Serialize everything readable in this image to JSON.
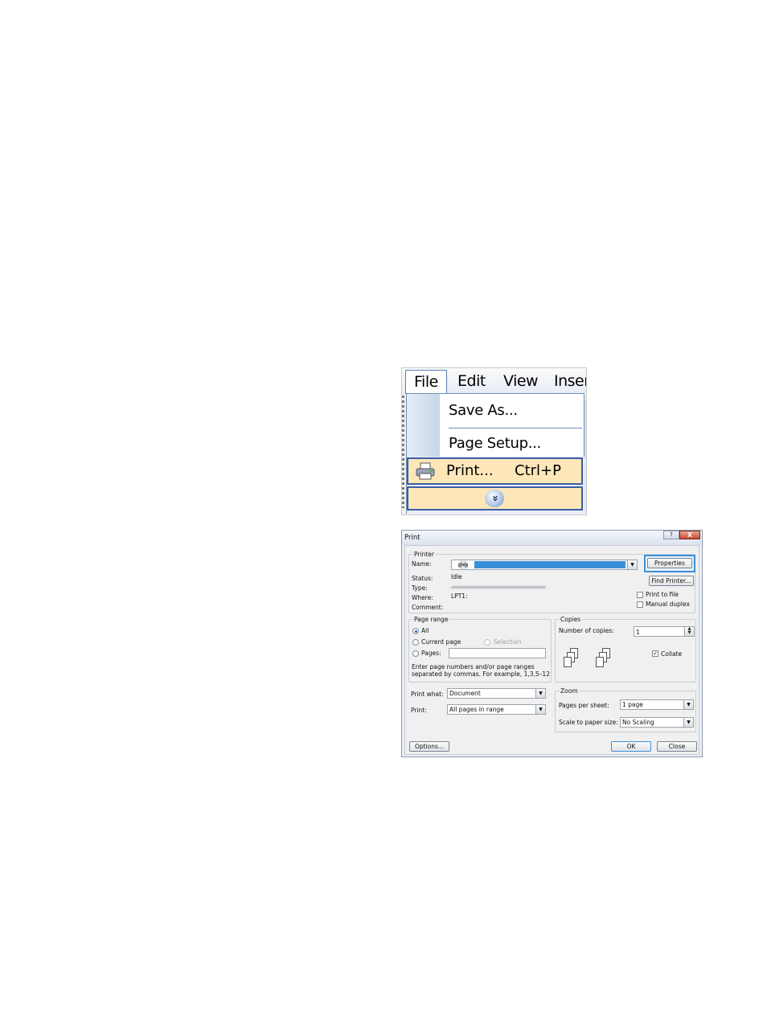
{
  "menu": {
    "bar": {
      "file": "File",
      "edit": "Edit",
      "view": "View",
      "insert": "Inser"
    },
    "items": {
      "save_as": "Save As...",
      "page_setup": "Page Setup...",
      "print": "Print...",
      "print_shortcut": "Ctrl+P",
      "expand_glyph": "»"
    }
  },
  "dialog": {
    "title": "Print",
    "title_help": "?",
    "title_close": "X",
    "printer": {
      "group_label": "Printer",
      "name_label": "Name:",
      "status_label": "Status:",
      "status_value": "Idle",
      "type_label": "Type:",
      "where_label": "Where:",
      "where_value": "LPT1:",
      "comment_label": "Comment:",
      "properties_button": "Properties",
      "find_printer_button": "Find Printer...",
      "print_to_file": "Print to file",
      "manual_duplex": "Manual duplex"
    },
    "page_range": {
      "group_label": "Page range",
      "all": "All",
      "current_page": "Current page",
      "selection": "Selection",
      "pages": "Pages:",
      "hint_line1": "Enter page numbers and/or page ranges",
      "hint_line2": "separated by commas.  For example, 1,3,5–12"
    },
    "copies": {
      "group_label": "Copies",
      "number_label": "Number of copies:",
      "number_value": "1",
      "collate": "Collate"
    },
    "print_what": {
      "label": "Print what:",
      "value": "Document"
    },
    "print_range": {
      "label": "Print:",
      "value": "All pages in range"
    },
    "zoom": {
      "group_label": "Zoom",
      "pages_per_sheet_label": "Pages per sheet:",
      "pages_per_sheet_value": "1 page",
      "scale_label": "Scale to paper size:",
      "scale_value": "No Scaling"
    },
    "buttons": {
      "options": "Options...",
      "ok": "OK",
      "close": "Close"
    }
  }
}
